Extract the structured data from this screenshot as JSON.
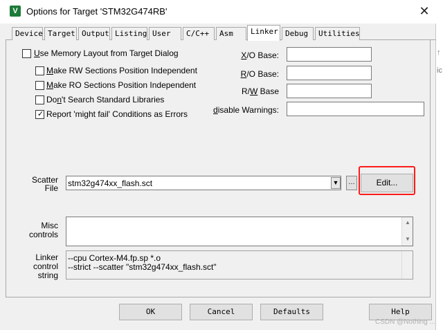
{
  "window": {
    "title": "Options for Target 'STM32G474RB'",
    "app_icon_glyph": "V",
    "close_glyph": "✕"
  },
  "tabs": [
    {
      "label": "Device"
    },
    {
      "label": "Target"
    },
    {
      "label": "Output"
    },
    {
      "label": "Listing"
    },
    {
      "label": "User"
    },
    {
      "label": "C/C++"
    },
    {
      "label": "Asm"
    },
    {
      "label": "Linker",
      "active": true
    },
    {
      "label": "Debug"
    },
    {
      "label": "Utilities"
    }
  ],
  "checkboxes": {
    "use_memory_layout": {
      "pre": "",
      "ul": "U",
      "post": "se Memory Layout from Target Dialog",
      "checked": false
    },
    "make_rw": {
      "pre": "",
      "ul": "M",
      "post": "ake RW Sections Position Independent",
      "checked": false
    },
    "make_ro": {
      "pre": "",
      "ul": "M",
      "post": "ake RO Sections Position Independent",
      "checked": false
    },
    "dont_search": {
      "pre": "Do",
      "ul": "n",
      "post": "'t Search Standard Libraries",
      "checked": false
    },
    "might_fail": {
      "pre": "Report 'might fail' Conditions as Errors",
      "ul": "",
      "post": "",
      "checked": true
    }
  },
  "check_glyph": "✓",
  "bases": {
    "xo": {
      "ul": "X",
      "post": "/O Base:",
      "value": ""
    },
    "ro": {
      "ul": "R",
      "post": "/O Base:",
      "value": ""
    },
    "rw": {
      "pre": "R/",
      "ul": "W",
      "post": " Base",
      "value": ""
    },
    "disable": {
      "ul": "d",
      "post": "isable Warnings:",
      "value": ""
    }
  },
  "scatter": {
    "label_line1": "Scatter",
    "label_line2": "File",
    "value": "stm32g474xx_flash.sct",
    "browse_glyph": "…",
    "dropdown_glyph": "▼",
    "edit_label": "Edit..."
  },
  "misc": {
    "label_line1": "Misc",
    "label_line2": "controls",
    "value": "",
    "up_glyph": "▲",
    "down_glyph": "▼"
  },
  "linker_string": {
    "label_line1": "Linker",
    "label_line2": "control",
    "label_line3": "string",
    "line1": "--cpu Cortex-M4.fp.sp *.o",
    "line2": "--strict --scatter \"stm32g474xx_flash.sct\""
  },
  "buttons": {
    "ok": "OK",
    "cancel": "Cancel",
    "defaults": "Defaults",
    "help": "Help"
  },
  "edge_glyphs": {
    "g1": "↑",
    "g2": "ic"
  },
  "watermark": "CSDN @Nothing ..."
}
